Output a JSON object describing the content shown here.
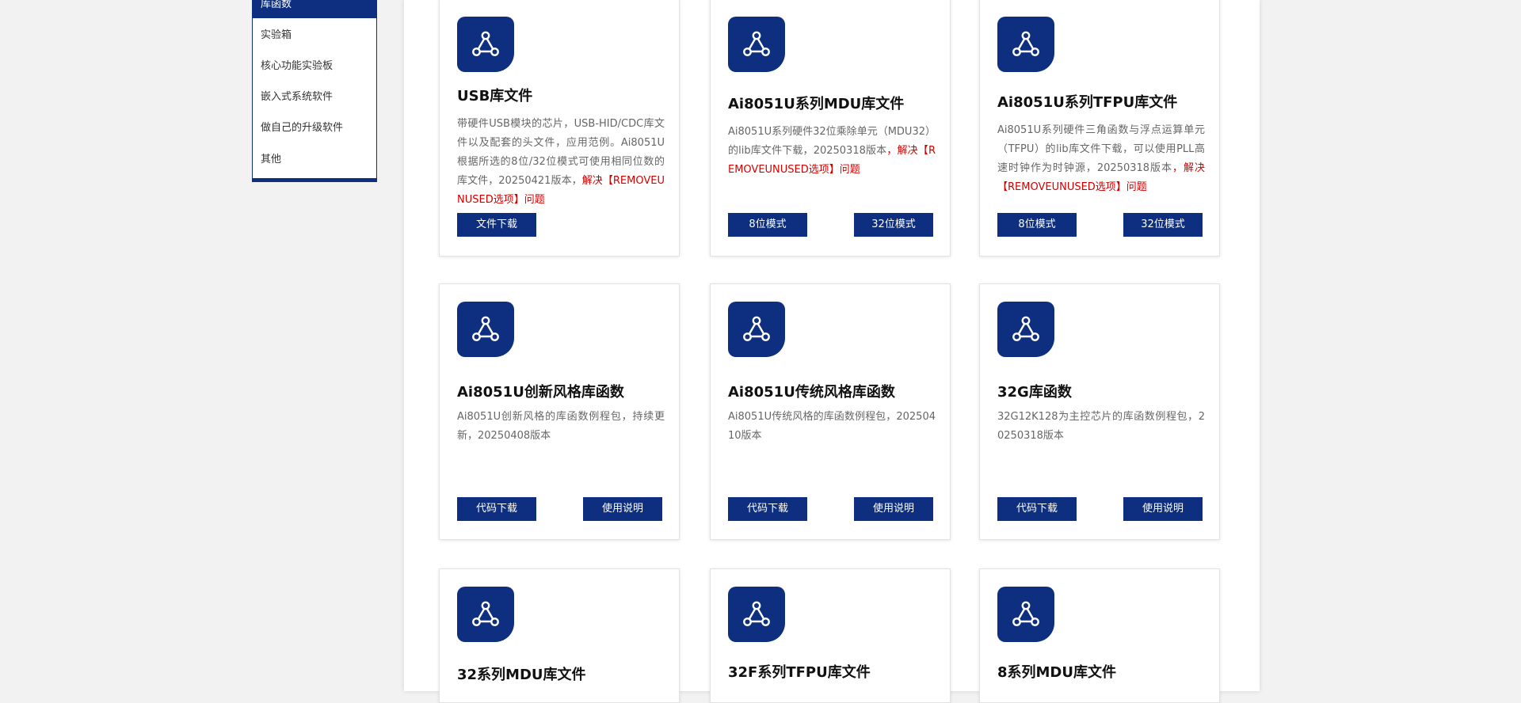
{
  "sidebar": {
    "active_label": "库函数",
    "items": [
      "实验箱",
      "核心功能实验板",
      "嵌入式系统软件",
      "做自己的升级软件",
      "其他"
    ]
  },
  "colors": {
    "brand": "#0e2f7f",
    "highlight": "#d40000"
  },
  "icon": "network-triangle-icon",
  "cards": [
    {
      "title": "USB库文件",
      "desc": "带硬件USB模块的芯片，USB-HID/CDC库文件以及配套的头文件，应用范例。Ai8051U根据所选的8位/32位模式可使用相同位数的库文件，20250421版本，",
      "highlight": "解决【REMOVEUNUSED选项】问题",
      "buttons": [
        "文件下载"
      ]
    },
    {
      "title": "Ai8051U系列MDU库文件",
      "desc": "Ai8051U系列硬件32位乘除单元（MDU32）的lib库文件下载，20250318版本",
      "highlight": "，解决【REMOVEUNUSED选项】问题",
      "buttons": [
        "8位模式",
        "32位模式"
      ]
    },
    {
      "title": "Ai8051U系列TFPU库文件",
      "desc": "Ai8051U系列硬件三角函数与浮点运算单元（TFPU）的lib库文件下载，可以使用PLL高速时钟作为时钟源，20250318版本",
      "highlight": "，解决【REMOVEUNUSED选项】问题",
      "buttons": [
        "8位模式",
        "32位模式"
      ]
    },
    {
      "title": "Ai8051U创新风格库函数",
      "desc": "Ai8051U创新风格的库函数例程包，持续更新，20250408版本",
      "highlight": "",
      "buttons": [
        "代码下载",
        "使用说明"
      ]
    },
    {
      "title": "Ai8051U传统风格库函数",
      "desc": "Ai8051U传统风格的库函数例程包，20250410版本",
      "highlight": "",
      "buttons": [
        "代码下载",
        "使用说明"
      ]
    },
    {
      "title": "32G库函数",
      "desc": "32G12K128为主控芯片的库函数例程包，20250318版本",
      "highlight": "",
      "buttons": [
        "代码下载",
        "使用说明"
      ]
    },
    {
      "title": "32系列MDU库文件",
      "desc": "",
      "highlight": "",
      "buttons": []
    },
    {
      "title": "32F系列TFPU库文件",
      "desc": "",
      "highlight": "",
      "buttons": []
    },
    {
      "title": "8系列MDU库文件",
      "desc": "",
      "highlight": "",
      "buttons": []
    }
  ]
}
